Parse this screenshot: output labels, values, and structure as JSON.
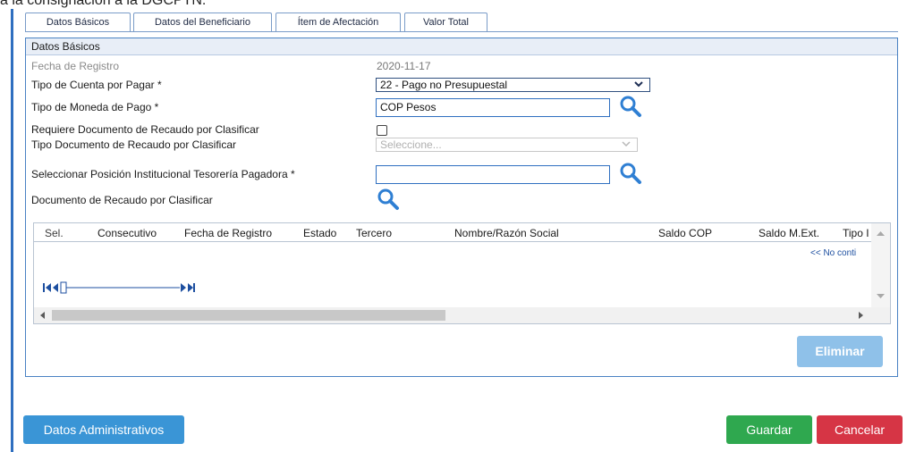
{
  "doc": {
    "top_text": "a la consignación a la DGCPTN."
  },
  "tabs": [
    {
      "label": "Datos Básicos"
    },
    {
      "label": "Datos del Beneficiario"
    },
    {
      "label": "Ítem de Afectación"
    },
    {
      "label": "Valor Total"
    }
  ],
  "panel": {
    "title": "Datos Básicos"
  },
  "form": {
    "fecha_registro": {
      "label": "Fecha de Registro",
      "value": "2020-11-17"
    },
    "tipo_cuenta": {
      "label": "Tipo de Cuenta por Pagar  *",
      "value": "22 - Pago no Presupuestal"
    },
    "tipo_moneda": {
      "label": "Tipo de Moneda de Pago  *",
      "value": "COP Pesos"
    },
    "requiere_doc": {
      "label": "Requiere Documento de Recaudo por Clasificar",
      "checked": false
    },
    "tipo_doc": {
      "label": "Tipo Documento de Recaudo por Clasificar",
      "placeholder": "Seleccione..."
    },
    "posicion": {
      "label": "Seleccionar Posición Institucional Tesorería Pagadora  *",
      "value": ""
    },
    "doc_recaudo": {
      "label": "Documento de Recaudo por Clasificar"
    }
  },
  "grid": {
    "columns": [
      "Sel.",
      "Consecutivo",
      "Fecha de Registro",
      "Estado",
      "Tercero",
      "Nombre/Razón Social",
      "Saldo COP",
      "Saldo M.Ext.",
      "Tipo I"
    ],
    "empty_text": "<< No conti"
  },
  "buttons": {
    "eliminar": "Eliminar",
    "datos_admin": "Datos Administrativos",
    "guardar": "Guardar",
    "cancelar": "Cancelar"
  },
  "colors": {
    "accent": "#2f6fc0",
    "guardar": "#2fa84f",
    "cancelar": "#d63545",
    "admin": "#3a95d6",
    "eliminar_disabled": "#8fc1e9"
  },
  "icons": {
    "search": "search-icon",
    "chevron": "chevron-down-icon",
    "first": "first-page-icon",
    "prev": "previous-page-icon",
    "next": "next-page-icon",
    "last": "last-page-icon"
  }
}
